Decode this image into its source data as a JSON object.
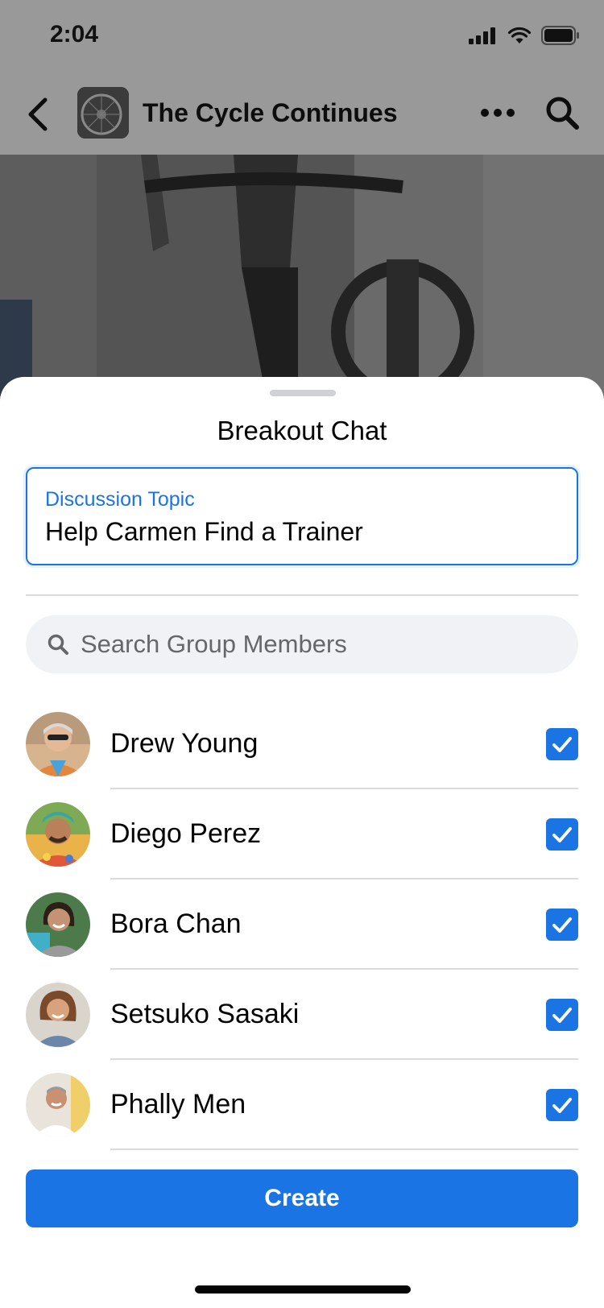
{
  "status_bar": {
    "time": "2:04"
  },
  "nav": {
    "group_title": "The Cycle Continues"
  },
  "sheet": {
    "title": "Breakout Chat",
    "topic": {
      "label": "Discussion Topic",
      "value": "Help Carmen Find a Trainer"
    },
    "search": {
      "placeholder": "Search Group Members"
    },
    "members": [
      {
        "name": "Drew Young",
        "checked": true
      },
      {
        "name": "Diego Perez",
        "checked": true
      },
      {
        "name": "Bora Chan",
        "checked": true
      },
      {
        "name": "Setsuko Sasaki",
        "checked": true
      },
      {
        "name": "Phally Men",
        "checked": true
      }
    ],
    "create_label": "Create"
  },
  "colors": {
    "accent": "#1b74e4",
    "overlay": "#999999",
    "search_bg": "#f0f2f5"
  }
}
